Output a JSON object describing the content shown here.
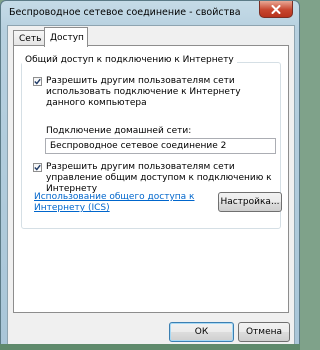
{
  "window": {
    "title": "Беспроводное сетевое соединение - свойства"
  },
  "tabs": {
    "network": "Сеть",
    "access": "Доступ"
  },
  "group": {
    "title": "Общий доступ к подключению к Интернету",
    "allow_internet_label": "Разрешить другим пользователям сети использовать подключение к Интернету данного компьютера",
    "allow_internet_checked": true,
    "home_connection_label": "Подключение домашней сети:",
    "home_connection_value": "Беспроводное сетевое соединение 2",
    "allow_control_label": "Разрешить другим пользователям сети управление общим доступом к подключению к Интернету",
    "allow_control_checked": true,
    "ics_link": "Использование общего доступа к Интернету (ICS)",
    "settings_button": "Настройка..."
  },
  "buttons": {
    "ok": "ОК",
    "cancel": "Отмена"
  },
  "icons": {
    "close": "close-icon",
    "check": "checkmark-icon"
  }
}
